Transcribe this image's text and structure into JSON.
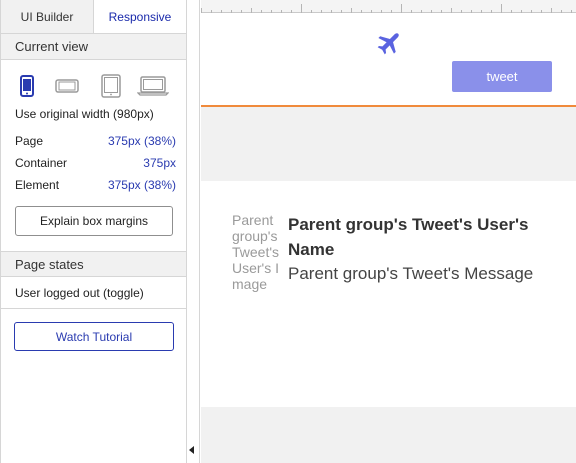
{
  "tabs": [
    {
      "label": "UI Builder",
      "active": false
    },
    {
      "label": "Responsive",
      "active": true
    }
  ],
  "current_view": {
    "header": "Current view",
    "devices": [
      "mobile-portrait-icon",
      "mobile-landscape-icon",
      "tablet-icon",
      "laptop-icon"
    ],
    "use_original": "Use original width (980px)",
    "rows": [
      {
        "label": "Page",
        "value": "375px (38%)"
      },
      {
        "label": "Container",
        "value": "375px"
      },
      {
        "label": "Element",
        "value": "375px (38%)"
      }
    ],
    "explain_button": "Explain box margins"
  },
  "page_states": {
    "header": "Page states",
    "items": [
      "User logged out (toggle)"
    ]
  },
  "watch_tutorial": "Watch Tutorial",
  "canvas": {
    "tweet_button": "tweet",
    "image_placeholder": "Parent group's Tweet's User's Image",
    "user_name": "Parent group's Tweet's User's Name",
    "message": "Parent group's Tweet's Message"
  },
  "colors": {
    "accent_blue": "#2a3bb0",
    "tweet_button": "#8a90ea",
    "header_border": "#f08a3b",
    "plane_icon": "#5a63e0"
  }
}
